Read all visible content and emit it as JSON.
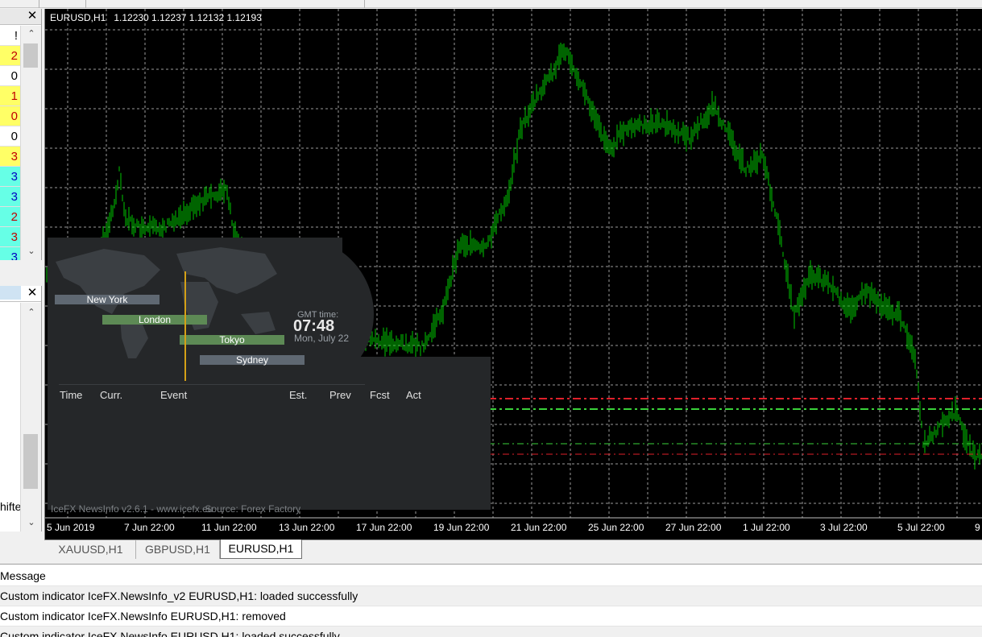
{
  "chart": {
    "title": "EURUSD,H1   1.12230 1.12237 1.12132 1.12193",
    "x_ticks": [
      "5 Jun 2019",
      "7 Jun 22:00",
      "11 Jun 22:00",
      "13 Jun 22:00",
      "17 Jun 22:00",
      "19 Jun 22:00",
      "21 Jun 22:00",
      "25 Jun 22:00",
      "27 Jun 22:00",
      "1 Jul 22:00",
      "3 Jul 22:00",
      "5 Jul 22:00",
      "9"
    ],
    "colors": {
      "background": "#000000",
      "bars": "#00c800",
      "grid": "#9a9a9a",
      "resistance": "#e0202a",
      "support": "#3ad23a"
    }
  },
  "left_panel_top": {
    "close_glyph": "✕",
    "header_glyph": "!",
    "values": [
      {
        "text": "2",
        "bg": "#ffff66",
        "color": "#c00000"
      },
      {
        "text": "0",
        "bg": "#ffffff",
        "color": "#000000"
      },
      {
        "text": "1",
        "bg": "#ffff66",
        "color": "#c00000"
      },
      {
        "text": "0",
        "bg": "#ffff66",
        "color": "#c00000"
      },
      {
        "text": "0",
        "bg": "#ffffff",
        "color": "#000000"
      },
      {
        "text": "3",
        "bg": "#ffff66",
        "color": "#c00000"
      },
      {
        "text": "3",
        "bg": "#66ffe6",
        "color": "#0000c0"
      },
      {
        "text": "3",
        "bg": "#66ffe6",
        "color": "#0000c0"
      },
      {
        "text": "2",
        "bg": "#66ffe6",
        "color": "#c00000"
      },
      {
        "text": "3",
        "bg": "#66ffe6",
        "color": "#c00000"
      },
      {
        "text": "3",
        "bg": "#66ffe6",
        "color": "#0000c0"
      }
    ]
  },
  "left_panel_bottom": {
    "close_glyph": "✕",
    "partial_text": "hifte"
  },
  "widget": {
    "sessions": [
      {
        "label": "New York",
        "color": "#5f6872"
      },
      {
        "label": "London",
        "color": "#5d8a55"
      },
      {
        "label": "Tokyo",
        "color": "#5d8a55"
      },
      {
        "label": "Sydney",
        "color": "#5f6872"
      }
    ],
    "gmt_label": "GMT time:",
    "gmt_time": "07:48",
    "gmt_date": "Mon, July 22",
    "columns": [
      "Time",
      "Curr.",
      "Event",
      "Est.",
      "Prev",
      "Fcst",
      "Act"
    ],
    "footer": "IceFX NewsInfo v2.6.1  -  www.icefx.eu",
    "source": "Source: Forex Factory"
  },
  "tabs": [
    {
      "label": "XAUUSD,H1",
      "active": false
    },
    {
      "label": "GBPUSD,H1",
      "active": false
    },
    {
      "label": "EURUSD,H1",
      "active": true
    }
  ],
  "journal": {
    "header": "Message",
    "rows": [
      "Custom indicator IceFX.NewsInfo_v2 EURUSD,H1: loaded successfully",
      "Custom indicator IceFX.NewsInfo EURUSD,H1: removed",
      "Custom indicator IceFX.NewsInfo EURUSD,H1: loaded successfully"
    ]
  }
}
